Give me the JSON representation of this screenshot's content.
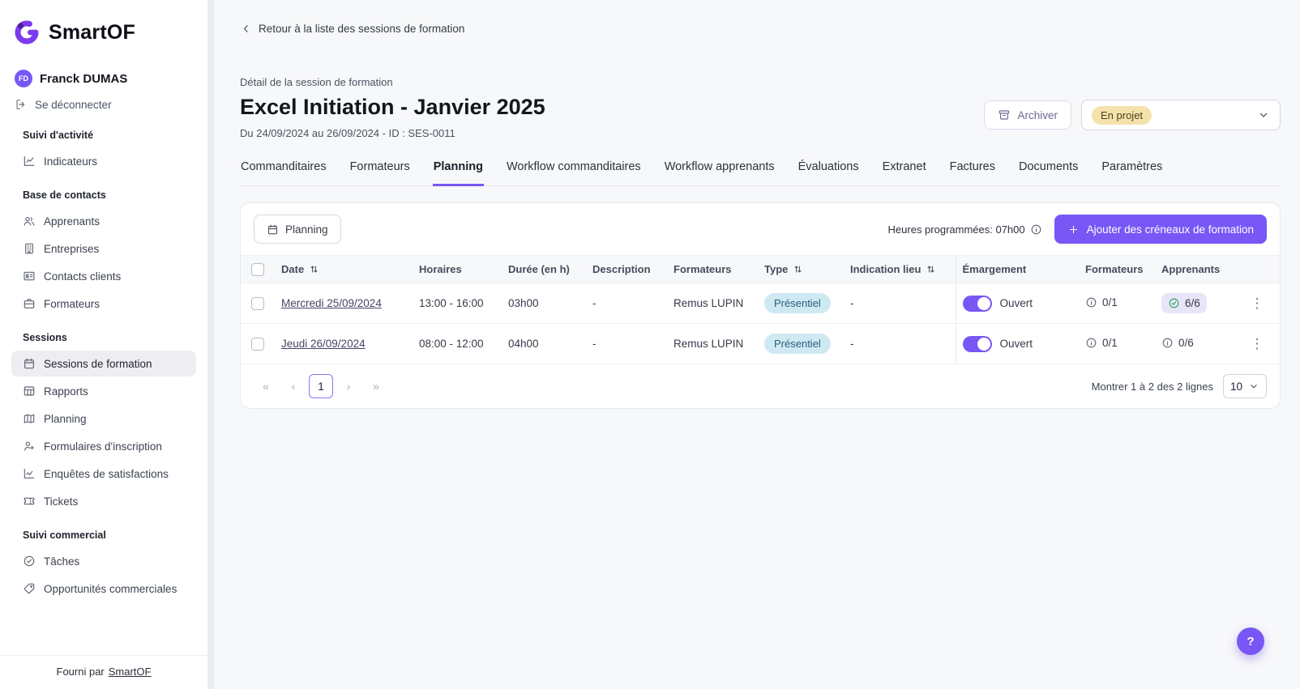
{
  "colors": {
    "primary": "#7857F6",
    "logo_purple": "#7C3AED",
    "status_badge_bg": "#F3E2AB",
    "type_badge_bg": "#CFE9F3",
    "success_green": "#1FA355",
    "active_item_bg": "#EDEDF2"
  },
  "icons": {
    "first": "«",
    "prev": "‹",
    "next": "›",
    "last": "»",
    "kebab": "⋮"
  },
  "sidebar": {
    "logo_text": "SmartOF",
    "user": {
      "initials": "FD",
      "name": "Franck DUMAS"
    },
    "logout_label": "Se déconnecter",
    "sections": [
      {
        "title": "Suivi d'activité",
        "items": [
          {
            "label": "Indicateurs",
            "icon": "chart-line-icon"
          }
        ]
      },
      {
        "title": "Base de contacts",
        "items": [
          {
            "label": "Apprenants",
            "icon": "users-icon"
          },
          {
            "label": "Entreprises",
            "icon": "building-icon"
          },
          {
            "label": "Contacts clients",
            "icon": "id-card-icon"
          },
          {
            "label": "Formateurs",
            "icon": "briefcase-icon"
          }
        ]
      },
      {
        "title": "Sessions",
        "items": [
          {
            "label": "Sessions de formation",
            "icon": "calendar-icon",
            "active": true
          },
          {
            "label": "Rapports",
            "icon": "table-icon"
          },
          {
            "label": "Planning",
            "icon": "map-icon"
          },
          {
            "label": "Formulaires d'inscription",
            "icon": "user-plus-icon"
          },
          {
            "label": "Enquêtes de satisfactions",
            "icon": "chart-trend-icon"
          },
          {
            "label": "Tickets",
            "icon": "ticket-icon"
          }
        ]
      },
      {
        "title": "Suivi commercial",
        "items": [
          {
            "label": "Tâches",
            "icon": "check-circle-icon"
          },
          {
            "label": "Opportunités commerciales",
            "icon": "tag-icon"
          }
        ]
      }
    ],
    "footer": {
      "prefix": "Fourni par",
      "link": "SmartOF"
    }
  },
  "header": {
    "back_link": "Retour à la liste des sessions de formation",
    "eyebrow": "Détail de la session de formation",
    "title": "Excel Initiation - Janvier 2025",
    "subtitle": "Du 24/09/2024 au 26/09/2024 - ID : SES-0011",
    "archive_label": "Archiver",
    "status_value": "En projet"
  },
  "tabs": [
    {
      "label": "Commanditaires"
    },
    {
      "label": "Formateurs"
    },
    {
      "label": "Planning",
      "active": true
    },
    {
      "label": "Workflow commanditaires"
    },
    {
      "label": "Workflow apprenants"
    },
    {
      "label": "Évaluations"
    },
    {
      "label": "Extranet"
    },
    {
      "label": "Factures"
    },
    {
      "label": "Documents"
    },
    {
      "label": "Paramètres"
    }
  ],
  "planning": {
    "view_button": "Planning",
    "hours_label": "Heures programmées: 07h00",
    "add_button": "Ajouter des créneaux de formation",
    "columns": {
      "date": "Date",
      "horaires": "Horaires",
      "duree": "Durée (en h)",
      "description": "Description",
      "formateurs": "Formateurs",
      "type": "Type",
      "indication_lieu": "Indication lieu",
      "emargement": "Émargement",
      "formateurs2": "Formateurs",
      "apprenants": "Apprenants"
    },
    "rows": [
      {
        "date": "Mercredi 25/09/2024",
        "horaires": "13:00 - 16:00",
        "duree": "03h00",
        "description": "-",
        "formateurs": "Remus LUPIN",
        "type": "Présentiel",
        "indication_lieu": "-",
        "emargement": "Ouvert",
        "formateurs_count": "0/1",
        "apprenants_count": "6/6"
      },
      {
        "date": "Jeudi 26/09/2024",
        "horaires": "08:00 - 12:00",
        "duree": "04h00",
        "description": "-",
        "formateurs": "Remus LUPIN",
        "type": "Présentiel",
        "indication_lieu": "-",
        "emargement": "Ouvert",
        "formateurs_count": "0/1",
        "apprenants_count": "0/6"
      }
    ],
    "pagination": {
      "current_page": "1",
      "summary": "Montrer 1 à 2 des 2 lignes",
      "page_size": "10"
    }
  },
  "help": {
    "label": "?"
  }
}
